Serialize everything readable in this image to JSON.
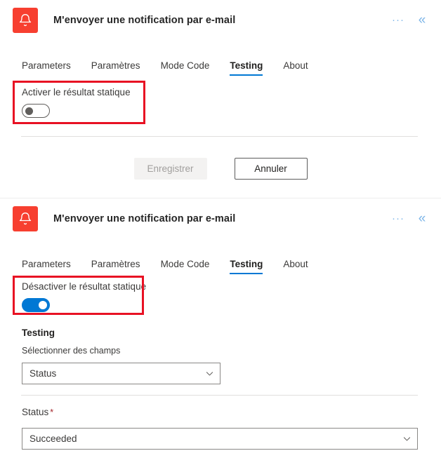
{
  "panel_top": {
    "header": {
      "icon_name": "bell-icon",
      "icon_color": "#f73f30",
      "title": "M'envoyer une notification par e-mail",
      "more_label": "···",
      "collapse_label": "«"
    },
    "tabs": [
      {
        "label": "Parameters",
        "active": false
      },
      {
        "label": "Paramètres",
        "active": false
      },
      {
        "label": "Mode Code",
        "active": false
      },
      {
        "label": "Testing",
        "active": true
      },
      {
        "label": "About",
        "active": false
      }
    ],
    "static_result_toggle": {
      "label": "Activer le résultat statique",
      "state": "off"
    },
    "buttons": {
      "save_label": "Enregistrer",
      "save_disabled": true,
      "cancel_label": "Annuler"
    }
  },
  "panel_bottom": {
    "header": {
      "icon_name": "bell-icon",
      "icon_color": "#f73f30",
      "title": "M'envoyer une notification par e-mail",
      "more_label": "···",
      "collapse_label": "«"
    },
    "tabs": [
      {
        "label": "Parameters",
        "active": false
      },
      {
        "label": "Paramètres",
        "active": false
      },
      {
        "label": "Mode Code",
        "active": false
      },
      {
        "label": "Testing",
        "active": true
      },
      {
        "label": "About",
        "active": false
      }
    ],
    "static_result_toggle": {
      "label": "Désactiver le résultat statique",
      "state": "on"
    },
    "testing_section": {
      "heading": "Testing",
      "select_fields_label": "Sélectionner des champs",
      "select_fields_value": "Status",
      "caret": "⌄"
    },
    "status_section": {
      "label": "Status",
      "required_marker": "*",
      "value": "Succeeded",
      "caret": "⌄"
    }
  },
  "highlight_color": "#e81123",
  "accent_color": "#0078d4"
}
